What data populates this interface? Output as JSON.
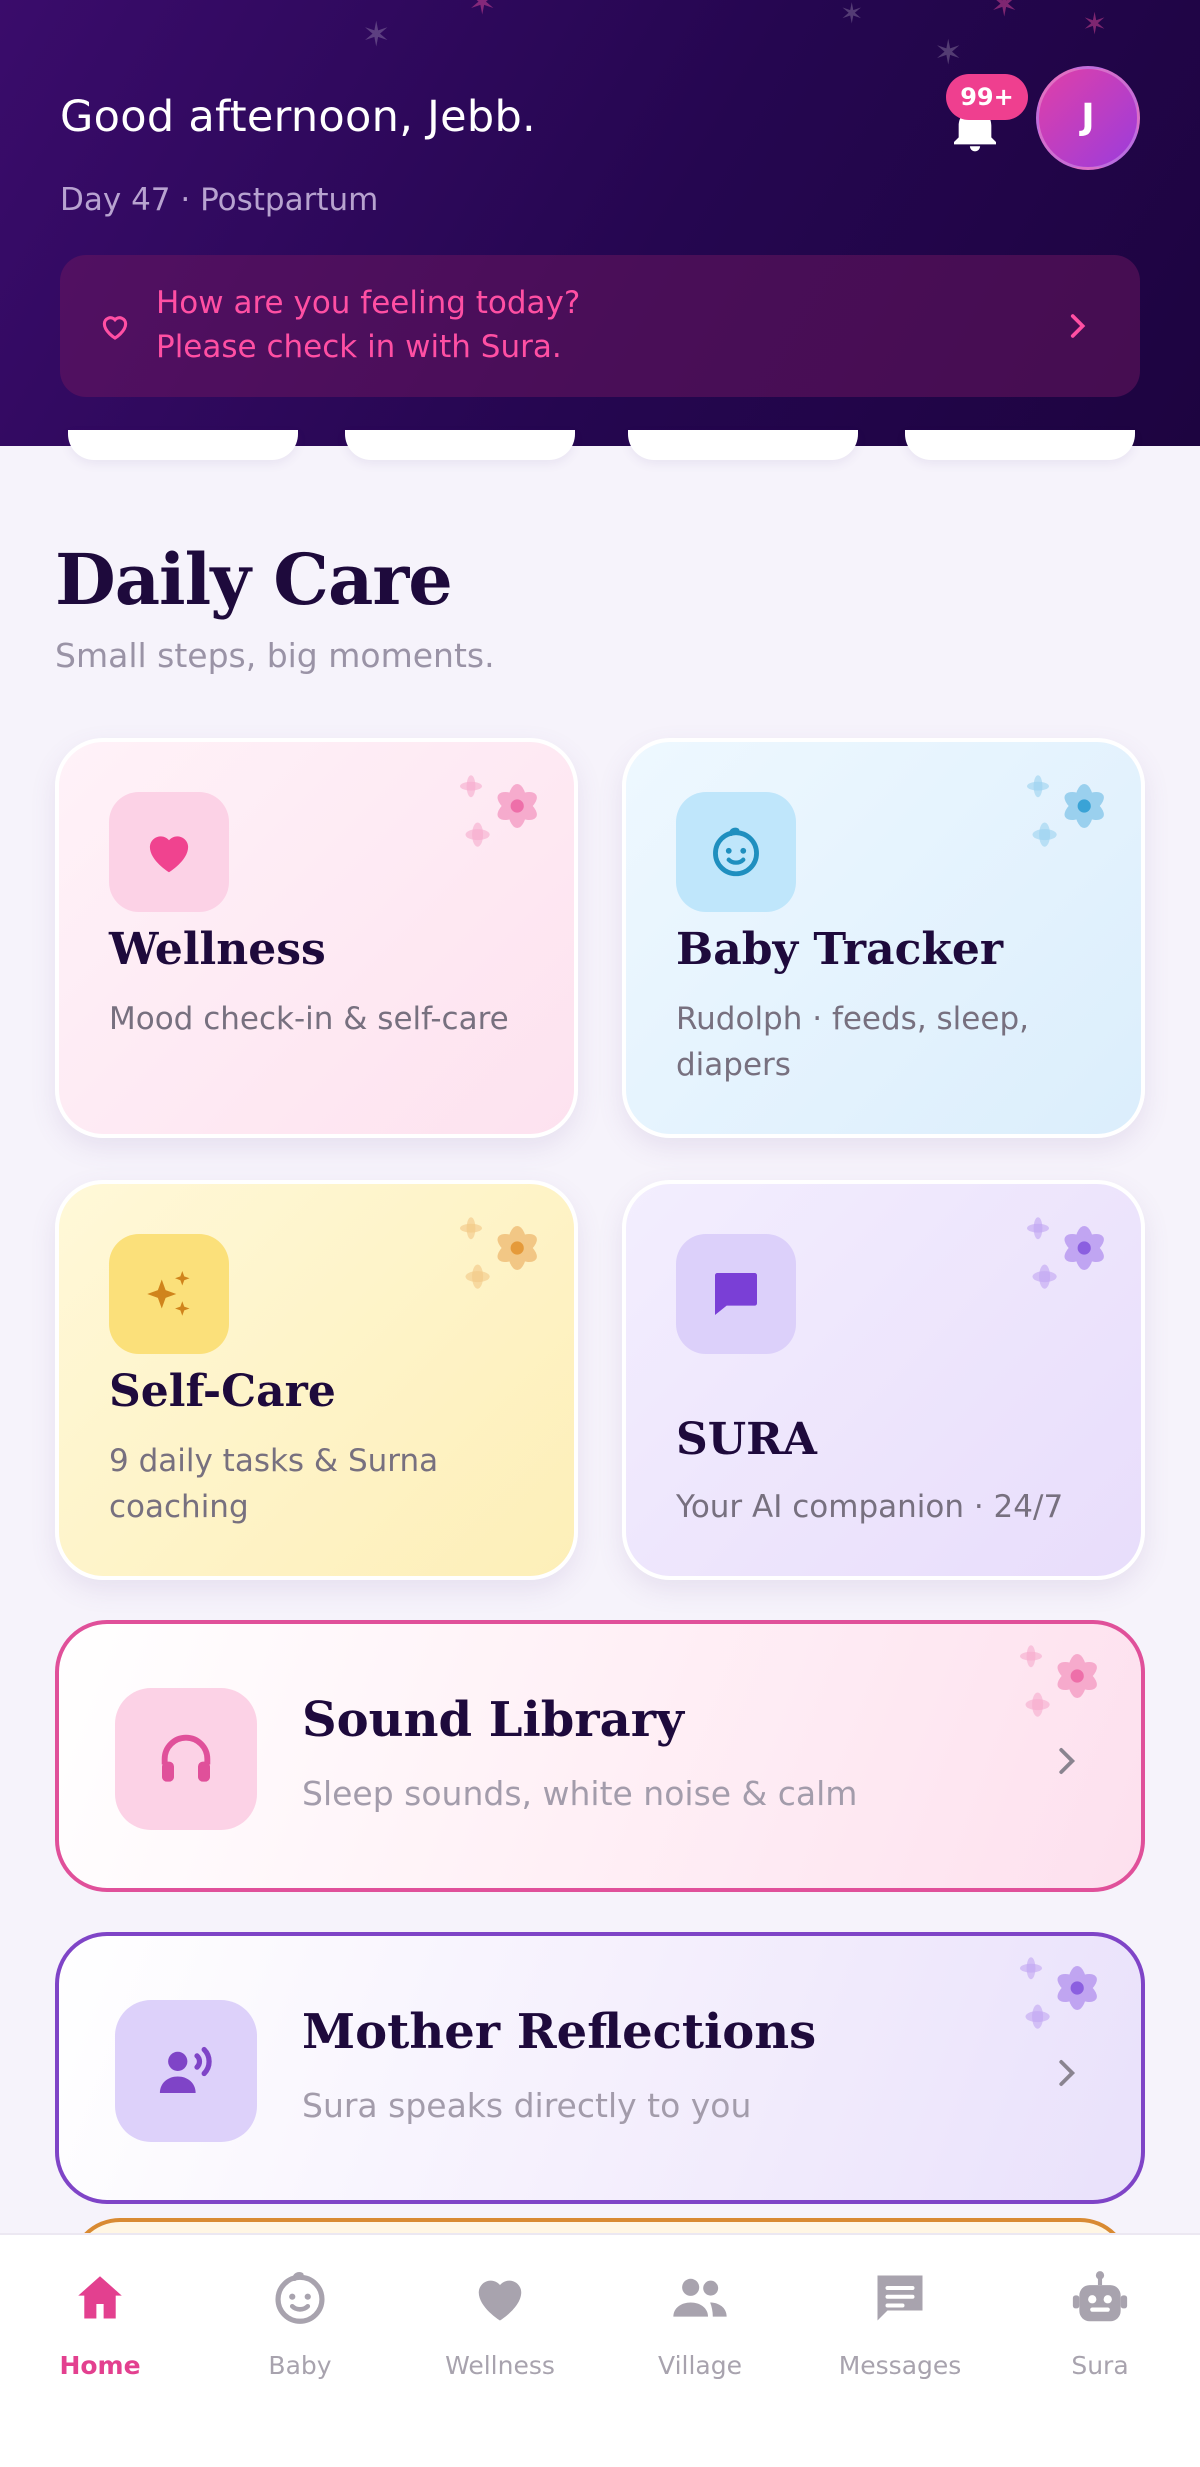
{
  "header": {
    "greeting": "Good afternoon, Jebb.",
    "subline": "Day 47 · Postpartum",
    "notification_badge": "99+",
    "avatar_initial": "J",
    "checkin_line1": "How are you feeling today?",
    "checkin_line2": "Please check in with Sura."
  },
  "section": {
    "title": "Daily Care",
    "subtitle": "Small steps, big moments."
  },
  "tiles": [
    {
      "title": "Wellness",
      "desc": "Mood check-in & self-care",
      "icon": "heart-icon",
      "color": "#f0438f"
    },
    {
      "title": "Baby Tracker",
      "desc": "Rudolph · feeds, sleep, diapers",
      "icon": "baby-face-icon",
      "color": "#1f8fbf"
    },
    {
      "title": "Self-Care",
      "desc": "9 daily tasks & Surna coaching",
      "icon": "sparkles-icon",
      "color": "#d0841c"
    },
    {
      "title": "SURA",
      "desc": "Your AI companion · 24/7",
      "icon": "chat-bubble-icon",
      "color": "#7a3fd6"
    }
  ],
  "wide_cards": [
    {
      "title": "Sound Library",
      "desc": "Sleep sounds, white noise & calm",
      "icon": "headphones-icon",
      "color": "#e0509a"
    },
    {
      "title": "Mother Reflections",
      "desc": "Sura speaks directly to you",
      "icon": "person-speaking-icon",
      "color": "#7f44c7"
    }
  ],
  "nav": {
    "items": [
      {
        "label": "Home",
        "icon": "home-icon",
        "active": true
      },
      {
        "label": "Baby",
        "icon": "baby-icon",
        "active": false
      },
      {
        "label": "Wellness",
        "icon": "heart-icon",
        "active": false
      },
      {
        "label": "Village",
        "icon": "people-icon",
        "active": false
      },
      {
        "label": "Messages",
        "icon": "message-icon",
        "active": false
      },
      {
        "label": "Sura",
        "icon": "robot-icon",
        "active": false
      }
    ]
  },
  "colors": {
    "accent_pink": "#e3408f",
    "header_bg": "#2a0858",
    "title_text": "#1e0a3c"
  }
}
